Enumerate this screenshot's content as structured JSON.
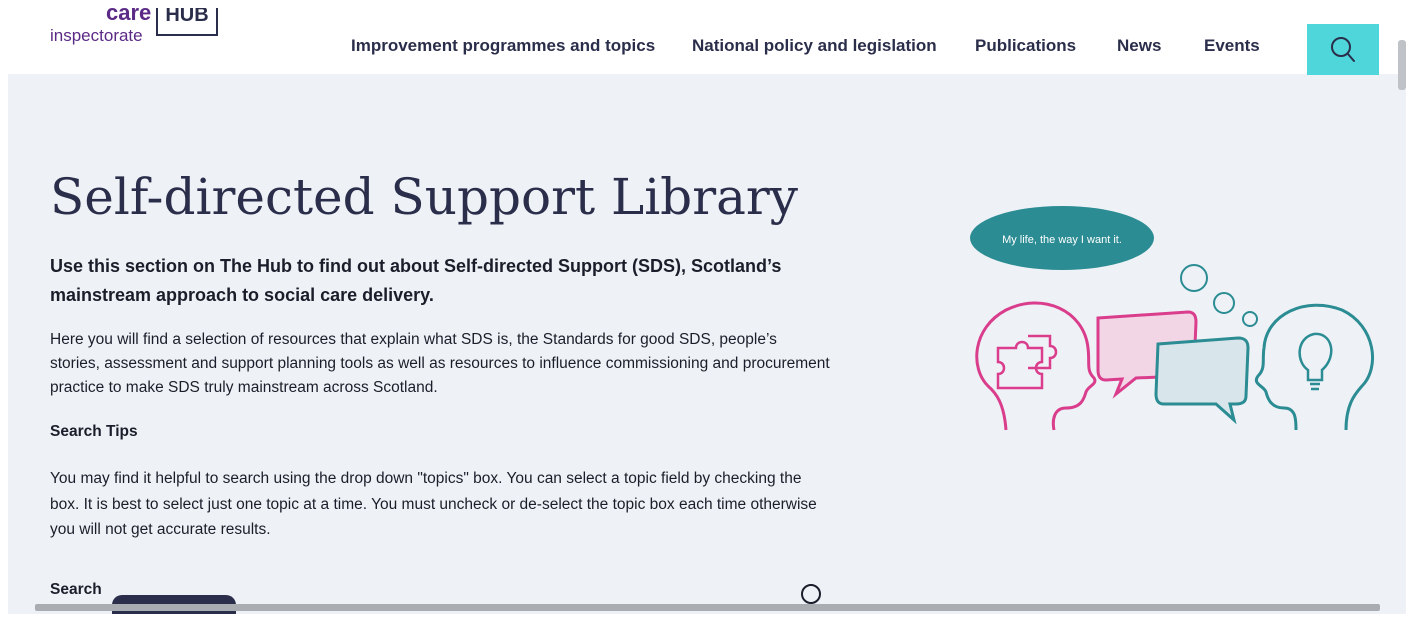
{
  "header": {
    "logo": {
      "line1": "care",
      "line2": "inspectorate",
      "hub": "HUB"
    },
    "nav": [
      {
        "label": "Improvement programmes and topics"
      },
      {
        "label": "National policy and legislation"
      },
      {
        "label": "Publications"
      },
      {
        "label": "News"
      },
      {
        "label": "Events"
      }
    ],
    "search_icon": "search-icon",
    "accent": "#4fd6da"
  },
  "main": {
    "title": "Self-directed Support Library",
    "lead": "Use this section on The Hub to find out about Self-directed Support (SDS), Scotland’s mainstream approach to social care delivery.",
    "intro": "Here you will find a selection of resources that explain what SDS is, the Standards for good SDS, people’s stories, assessment and support planning tools as well as resources to influence commissioning and procurement practice to make SDS truly mainstream across Scotland.",
    "search_tips_heading": "Search Tips",
    "search_tips": "You may find it helpful to search using the drop down \"topics\" box.  You can select a topic field by checking the box.  It is best to select just one topic at a time.  You must uncheck or de-select the topic box each time otherwise you will not get accurate results.",
    "search_label": "Search"
  },
  "illustration": {
    "speech_text": "My life, the way I want it.",
    "colors": {
      "teal": "#2b8c93",
      "pink": "#d93d8c",
      "light_pink": "#f3d6e6",
      "light_blue": "#d8e6ec"
    }
  }
}
